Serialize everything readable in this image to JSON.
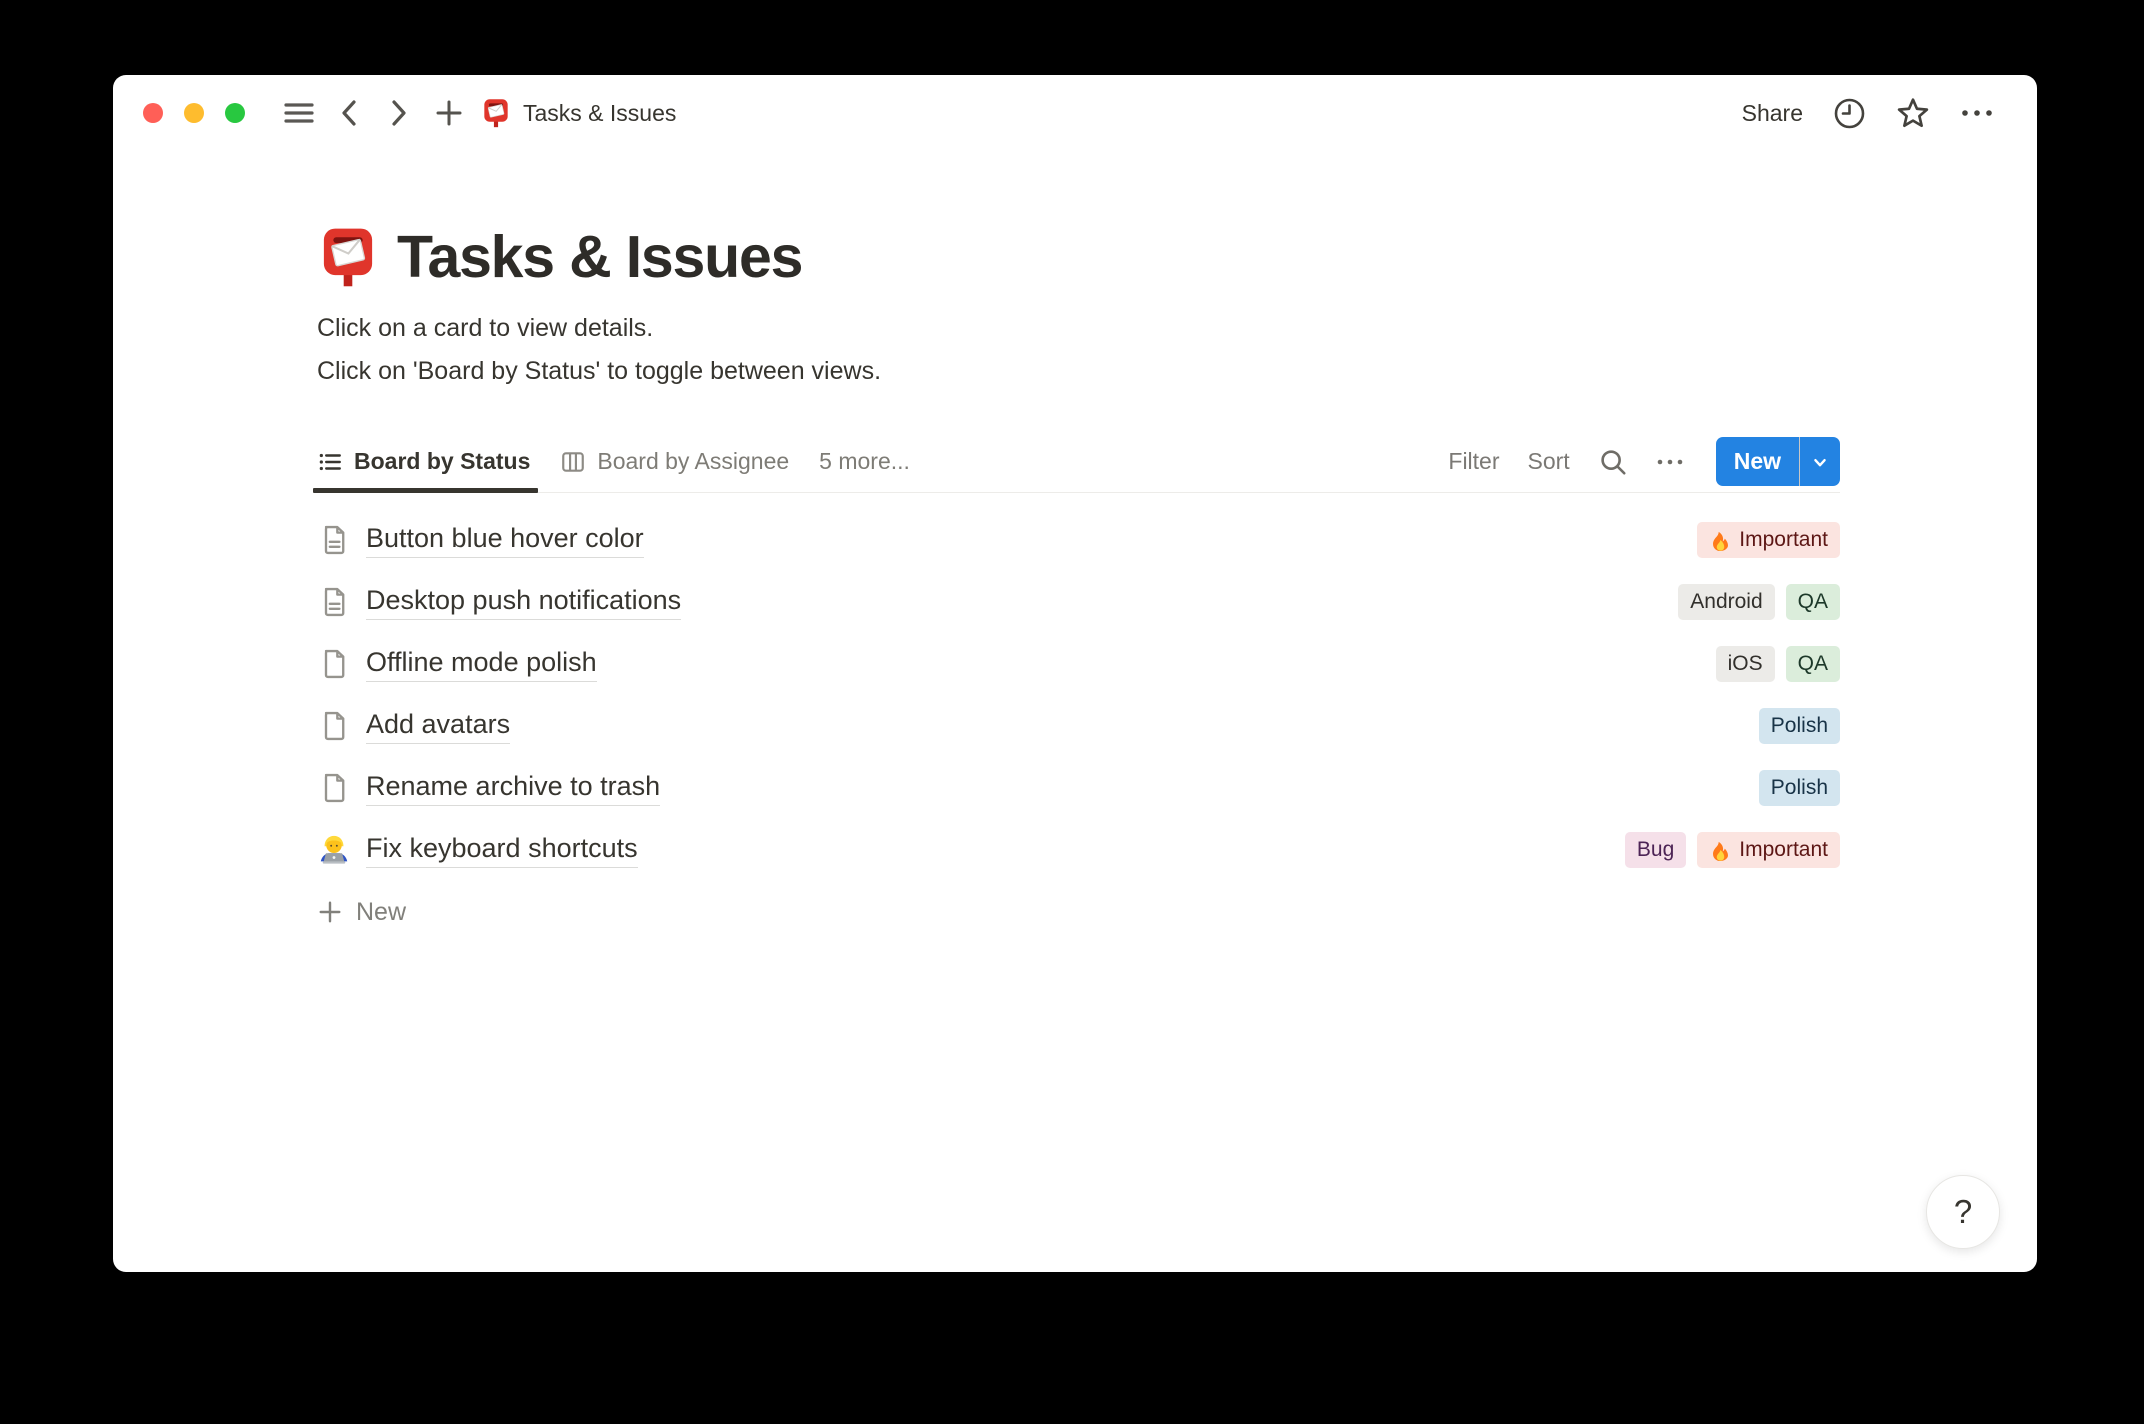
{
  "colors": {
    "accent_blue": "#2383E2",
    "traffic_red": "#FF5F57",
    "traffic_yellow": "#FEBC2E",
    "traffic_green": "#28C840",
    "tag_red_bg": "#FBE4E0",
    "tag_gray_bg": "#ECEBE8",
    "tag_green_bg": "#DBEDDB",
    "tag_blue_bg": "#D3E5EF",
    "tag_pink_bg": "#F5E0E9"
  },
  "toolbar": {
    "window_title": "Tasks & Issues",
    "title_icon": "postbox-emoji-icon",
    "share_label": "Share",
    "right_icons": [
      "history-clock-icon",
      "star-icon",
      "more-ellipsis-icon"
    ]
  },
  "page": {
    "title": "Tasks & Issues",
    "title_icon": "postbox-emoji-icon",
    "description_line1": "Click on a card to view details.",
    "description_line2": "Click on 'Board by Status' to toggle between views."
  },
  "view_bar": {
    "tabs": [
      {
        "label": "Board by Status",
        "icon": "list-view-icon",
        "active": true
      },
      {
        "label": "Board by Assignee",
        "icon": "board-view-icon",
        "active": false
      }
    ],
    "more_label": "5 more...",
    "filter_label": "Filter",
    "sort_label": "Sort",
    "icons": [
      "search-icon",
      "more-ellipsis-icon"
    ],
    "new_button_label": "New",
    "new_button_icon": "chevron-down-icon"
  },
  "rows": [
    {
      "icon": "page-text-icon",
      "title": "Button blue hover color",
      "tags": [
        {
          "label": "Important",
          "icon": "fire-icon",
          "color": "red"
        }
      ]
    },
    {
      "icon": "page-text-icon",
      "title": "Desktop push notifications",
      "tags": [
        {
          "label": "Android",
          "color": "gray"
        },
        {
          "label": "QA",
          "color": "green"
        }
      ]
    },
    {
      "icon": "page-blank-icon",
      "title": "Offline mode polish",
      "tags": [
        {
          "label": "iOS",
          "color": "gray"
        },
        {
          "label": "QA",
          "color": "green"
        }
      ]
    },
    {
      "icon": "page-blank-icon",
      "title": "Add avatars",
      "tags": [
        {
          "label": "Polish",
          "color": "blue"
        }
      ]
    },
    {
      "icon": "page-blank-icon",
      "title": "Rename archive to trash",
      "tags": [
        {
          "label": "Polish",
          "color": "blue"
        }
      ]
    },
    {
      "icon": "technologist-emoji-icon",
      "title": "Fix keyboard shortcuts",
      "tags": [
        {
          "label": "Bug",
          "color": "pink"
        },
        {
          "label": "Important",
          "icon": "fire-icon",
          "color": "red"
        }
      ]
    }
  ],
  "footer": {
    "new_row_label": "New",
    "help_label": "?"
  }
}
